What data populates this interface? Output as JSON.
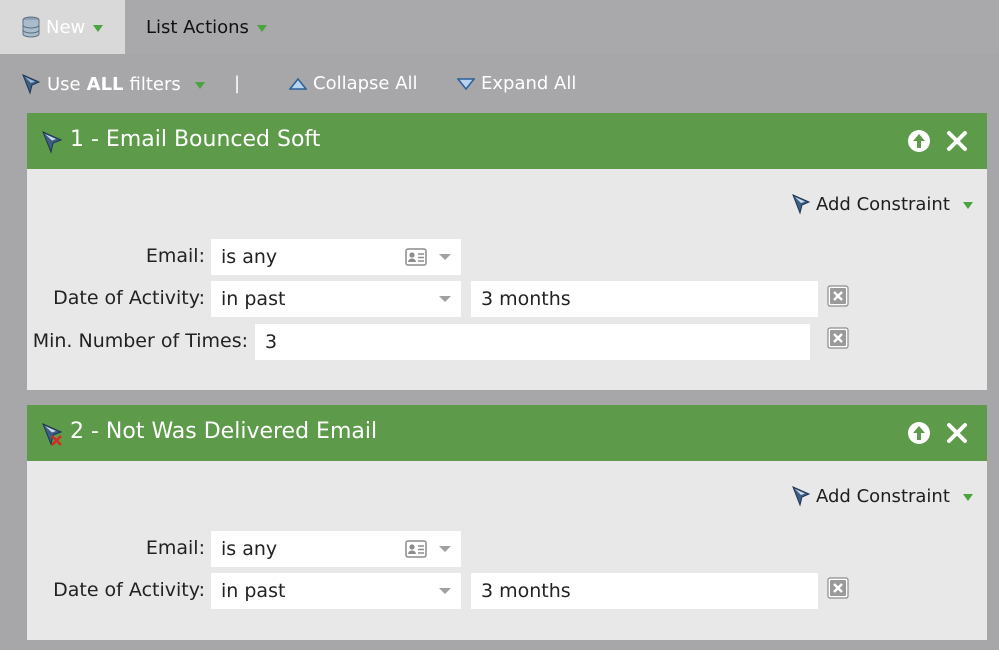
{
  "tabs": {
    "new_label": "New",
    "list_actions_label": "List Actions"
  },
  "toolbar": {
    "use_prefix": "Use",
    "use_bold": "ALL",
    "use_suffix": "filters",
    "separator": "|",
    "collapse_label": "Collapse All",
    "expand_label": "Expand All"
  },
  "filters": [
    {
      "title": "1 - Email Bounced Soft",
      "add_constraint_label": "Add Constraint",
      "email_label": "Email:",
      "email_value": "is any",
      "date_label": "Date of Activity:",
      "date_operator": "in past",
      "date_value": "3 months",
      "min_label": "Min. Number of Times:",
      "min_value": "3"
    },
    {
      "title": "2 - Not Was Delivered Email",
      "add_constraint_label": "Add Constraint",
      "email_label": "Email:",
      "email_value": "is any",
      "date_label": "Date of Activity:",
      "date_operator": "in past",
      "date_value": "3 months"
    }
  ],
  "colors": {
    "header_green": "#5d9a4a",
    "caret_green": "#49a33e",
    "panel_bg": "#e8e8e8",
    "page_bg": "#a7a7a9"
  },
  "icons": {
    "database": "database-icon",
    "filter": "filter-funnel-icon",
    "negated_filter": "negated-filter-icon",
    "move_up": "arrow-up-circle-icon",
    "delete": "close-x-icon",
    "contact_card": "contact-card-icon",
    "remove_constraint": "remove-constraint-icon"
  }
}
